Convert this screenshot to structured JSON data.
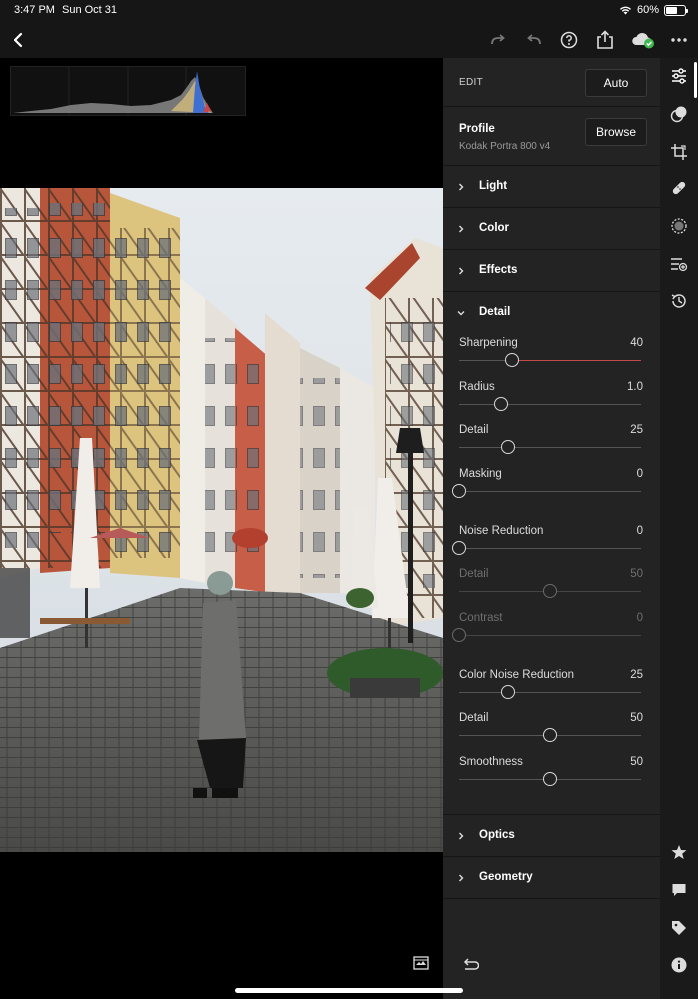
{
  "status": {
    "time": "3:47 PM",
    "date": "Sun Oct 31",
    "battery": "60%",
    "battery_level": 0.6
  },
  "panel": {
    "edit_label": "EDIT",
    "auto_label": "Auto",
    "profile": {
      "title": "Profile",
      "value": "Kodak Portra 800 v4",
      "browse_label": "Browse"
    },
    "sections": {
      "light": "Light",
      "color": "Color",
      "effects": "Effects",
      "detail": "Detail",
      "optics": "Optics",
      "geometry": "Geometry"
    },
    "sliders": [
      {
        "label": "Sharpening",
        "value": "40",
        "level": 0.29
      },
      {
        "label": "Radius",
        "value": "1.0",
        "level": 0.23
      },
      {
        "label": "Detail",
        "value": "25",
        "level": 0.27
      },
      {
        "label": "Masking",
        "value": "0",
        "level": 0.0
      },
      {
        "label": "Noise Reduction",
        "value": "0",
        "level": 0.0
      },
      {
        "label": "Detail",
        "value": "50",
        "level": 0.5,
        "disabled": true
      },
      {
        "label": "Contrast",
        "value": "0",
        "level": 0.0,
        "disabled": true
      },
      {
        "label": "Color Noise Reduction",
        "value": "25",
        "level": 0.27
      },
      {
        "label": "Detail",
        "value": "50",
        "level": 0.5
      },
      {
        "label": "Smoothness",
        "value": "50",
        "level": 0.5
      }
    ]
  },
  "icons": {
    "toolbar": [
      "back-icon",
      "redo-icon",
      "undo-icon",
      "help-icon",
      "share-icon",
      "cloud-sync-icon",
      "more-icon"
    ],
    "rail": [
      "edit-sliders-icon",
      "presets-icon",
      "crop-icon",
      "healing-icon",
      "masking-icon",
      "versions-icon",
      "history-icon",
      "star-icon",
      "comment-icon",
      "tag-icon",
      "info-icon"
    ]
  },
  "colors": {
    "panel_bg": "#232323",
    "accent_red": "#c54b4b",
    "cloud_green": "#3fb950"
  }
}
